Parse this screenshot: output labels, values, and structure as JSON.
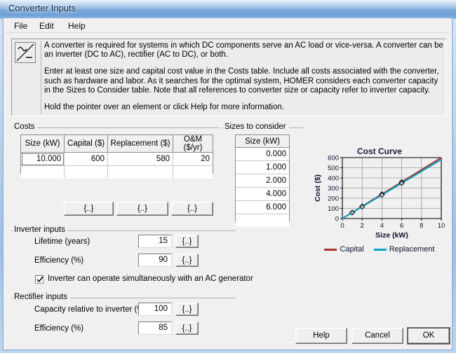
{
  "window": {
    "title": "Converter Inputs"
  },
  "menu": {
    "items": [
      {
        "label": "File"
      },
      {
        "label": "Edit"
      },
      {
        "label": "Help"
      }
    ]
  },
  "description": {
    "icon": "converter-icon",
    "paragraphs": [
      "A converter is required for systems in which DC components serve an AC load or vice-versa. A converter can be an inverter (DC to AC), rectifier (AC to DC), or both.",
      "Enter at least one size and capital cost value in the Costs table. Include all costs associated with the converter, such as hardware and labor. As it searches for the optimal system, HOMER considers each converter capacity in the Sizes to Consider table. Note that all references to converter size or capacity refer to inverter capacity.",
      "Hold the pointer over an element or click Help for more information."
    ]
  },
  "costs": {
    "group_label": "Costs",
    "headers": [
      "Size (kW)",
      "Capital ($)",
      "Replacement ($)",
      "O&M ($/yr)"
    ],
    "rows": [
      [
        "10.000",
        "600",
        "580",
        "20"
      ],
      [
        "",
        "",
        "",
        ""
      ]
    ],
    "curly_buttons": [
      {
        "label": "{..}"
      },
      {
        "label": "{..}"
      },
      {
        "label": "{..}"
      }
    ]
  },
  "sizes_to_consider": {
    "group_label": "Sizes to consider",
    "header": "Size (kW)",
    "values": [
      "0.000",
      "1.000",
      "2.000",
      "4.000",
      "6.000",
      ""
    ]
  },
  "inverter": {
    "group_label": "Inverter inputs",
    "lifetime_label": "Lifetime (years)",
    "lifetime_value": "15",
    "lifetime_button": "{..}",
    "efficiency_label": "Efficiency (%)",
    "efficiency_value": "90",
    "efficiency_button": "{..}",
    "checkbox_label": "Inverter can operate simultaneously with an AC generator",
    "checkbox_checked": true
  },
  "rectifier": {
    "group_label": "Rectifier inputs",
    "capacity_label": "Capacity relative to inverter (%)",
    "capacity_value": "100",
    "capacity_button": "{..}",
    "efficiency_label": "Efficiency (%)",
    "efficiency_value": "85",
    "efficiency_button": "{..}"
  },
  "footer": {
    "help_label": "Help",
    "cancel_label": "Cancel",
    "ok_label": "OK"
  },
  "colors": {
    "capital": "#a83232",
    "replacement": "#00a8c8",
    "titlebar": "#7ca9db",
    "window_bg": "#f0f0f0"
  },
  "chart_data": {
    "type": "line",
    "title": "Cost Curve",
    "xlabel": "Size (kW)",
    "ylabel": "Cost ($)",
    "xlim": [
      0,
      10
    ],
    "ylim": [
      0,
      600
    ],
    "xticks": [
      0,
      2,
      4,
      6,
      8,
      10
    ],
    "yticks": [
      0,
      100,
      200,
      300,
      400,
      500,
      600
    ],
    "grid": true,
    "legend_position": "bottom",
    "x": [
      0,
      1,
      2,
      4,
      6,
      10
    ],
    "series": [
      {
        "name": "Capital",
        "color": "#a83232",
        "values": [
          0,
          60,
          120,
          240,
          360,
          600
        ],
        "markers_x": [
          1,
          2,
          4,
          6
        ],
        "markers_y": [
          60,
          120,
          240,
          360
        ]
      },
      {
        "name": "Replacement",
        "color": "#00a8c8",
        "values": [
          0,
          58,
          116,
          232,
          348,
          580
        ],
        "markers_x": [
          1,
          2,
          4,
          6
        ],
        "markers_y": [
          58,
          116,
          232,
          348
        ]
      }
    ]
  }
}
